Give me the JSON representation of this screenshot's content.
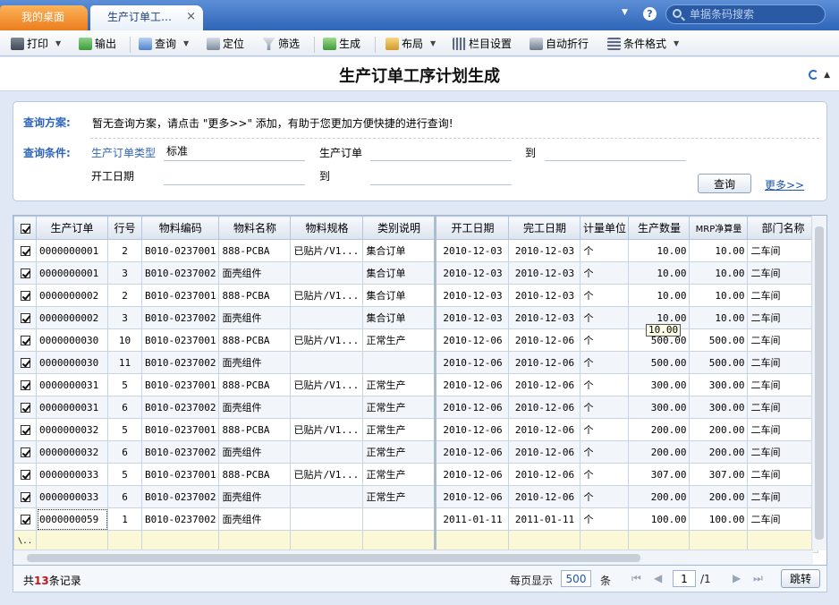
{
  "tabs": {
    "home": "我的桌面",
    "active": "生产订单工…",
    "close": "×"
  },
  "topbar": {
    "help": "?",
    "search_placeholder": "单据条码搜索"
  },
  "toolbar": {
    "print": "打印",
    "export": "输出",
    "query": "查询",
    "locate": "定位",
    "filter": "筛选",
    "generate": "生成",
    "layout": "布局",
    "columns": "栏目设置",
    "autowrap": "自动折行",
    "condformat": "条件格式"
  },
  "page": {
    "title": "生产订单工序计划生成"
  },
  "query": {
    "scheme_label": "查询方案:",
    "scheme_text": "暂无查询方案，请点击 \"更多>>\" 添加，有助于您更加方便快捷的进行查询!",
    "cond_label": "查询条件:",
    "order_type_label": "生产订单类型",
    "order_type_value": "标准",
    "order_label": "生产订单",
    "order_from": "",
    "to1": "到",
    "order_to": "",
    "start_label": "开工日期",
    "start_from": "",
    "to2": "到",
    "start_to": "",
    "query_button": "查询",
    "more": "更多>>"
  },
  "grid": {
    "columns": [
      "生产订单",
      "行号",
      "物料编码",
      "物料名称",
      "物料规格",
      "类别说明",
      "开工日期",
      "完工日期",
      "计量单位",
      "生产数量",
      "MRP净算量",
      "部门名称"
    ],
    "rows": [
      {
        "order": "0000000001",
        "line": "2",
        "code": "B010-0237001",
        "name": "888-PCBA",
        "spec": "已贴片/V1...",
        "cat": "集合订单",
        "start": "2010-12-03",
        "end": "2010-12-03",
        "unit": "个",
        "qty": "10.00",
        "mrp": "10.00",
        "dept": "二车间"
      },
      {
        "order": "0000000001",
        "line": "3",
        "code": "B010-0237002",
        "name": "面壳组件",
        "spec": "",
        "cat": "集合订单",
        "start": "2010-12-03",
        "end": "2010-12-03",
        "unit": "个",
        "qty": "10.00",
        "mrp": "10.00",
        "dept": "二车间"
      },
      {
        "order": "0000000002",
        "line": "2",
        "code": "B010-0237001",
        "name": "888-PCBA",
        "spec": "已贴片/V1...",
        "cat": "集合订单",
        "start": "2010-12-03",
        "end": "2010-12-03",
        "unit": "个",
        "qty": "10.00",
        "mrp": "10.00",
        "dept": "二车间"
      },
      {
        "order": "0000000002",
        "line": "3",
        "code": "B010-0237002",
        "name": "面壳组件",
        "spec": "",
        "cat": "集合订单",
        "start": "2010-12-03",
        "end": "2010-12-03",
        "unit": "个",
        "qty": "10.00",
        "mrp": "10.00",
        "dept": "二车间"
      },
      {
        "order": "0000000030",
        "line": "10",
        "code": "B010-0237001",
        "name": "888-PCBA",
        "spec": "已贴片/V1...",
        "cat": "正常生产",
        "start": "2010-12-06",
        "end": "2010-12-06",
        "unit": "个",
        "qty": "500.00",
        "mrp": "500.00",
        "dept": "二车间"
      },
      {
        "order": "0000000030",
        "line": "11",
        "code": "B010-0237002",
        "name": "面壳组件",
        "spec": "",
        "cat": "",
        "start": "2010-12-06",
        "end": "2010-12-06",
        "unit": "个",
        "qty": "500.00",
        "mrp": "500.00",
        "dept": "二车间"
      },
      {
        "order": "0000000031",
        "line": "5",
        "code": "B010-0237001",
        "name": "888-PCBA",
        "spec": "已贴片/V1...",
        "cat": "正常生产",
        "start": "2010-12-06",
        "end": "2010-12-06",
        "unit": "个",
        "qty": "300.00",
        "mrp": "300.00",
        "dept": "二车间"
      },
      {
        "order": "0000000031",
        "line": "6",
        "code": "B010-0237002",
        "name": "面壳组件",
        "spec": "",
        "cat": "正常生产",
        "start": "2010-12-06",
        "end": "2010-12-06",
        "unit": "个",
        "qty": "300.00",
        "mrp": "300.00",
        "dept": "二车间"
      },
      {
        "order": "0000000032",
        "line": "5",
        "code": "B010-0237001",
        "name": "888-PCBA",
        "spec": "已贴片/V1...",
        "cat": "正常生产",
        "start": "2010-12-06",
        "end": "2010-12-06",
        "unit": "个",
        "qty": "200.00",
        "mrp": "200.00",
        "dept": "二车间"
      },
      {
        "order": "0000000032",
        "line": "6",
        "code": "B010-0237002",
        "name": "面壳组件",
        "spec": "",
        "cat": "正常生产",
        "start": "2010-12-06",
        "end": "2010-12-06",
        "unit": "个",
        "qty": "200.00",
        "mrp": "200.00",
        "dept": "二车间"
      },
      {
        "order": "0000000033",
        "line": "5",
        "code": "B010-0237001",
        "name": "888-PCBA",
        "spec": "已贴片/V1...",
        "cat": "正常生产",
        "start": "2010-12-06",
        "end": "2010-12-06",
        "unit": "个",
        "qty": "307.00",
        "mrp": "307.00",
        "dept": "二车间"
      },
      {
        "order": "0000000033",
        "line": "6",
        "code": "B010-0237002",
        "name": "面壳组件",
        "spec": "",
        "cat": "正常生产",
        "start": "2010-12-06",
        "end": "2010-12-06",
        "unit": "个",
        "qty": "200.00",
        "mrp": "200.00",
        "dept": "二车间"
      },
      {
        "order": "0000000059",
        "line": "1",
        "code": "B010-0237002",
        "name": "面壳组件",
        "spec": "",
        "cat": "",
        "start": "2011-01-11",
        "end": "2011-01-11",
        "unit": "个",
        "qty": "100.00",
        "mrp": "100.00",
        "dept": "二车间"
      }
    ],
    "tooltip": "10.00",
    "new_row_marker": "\\.."
  },
  "footer": {
    "prefix": "共",
    "count": "13",
    "suffix": "条记录",
    "per_page_label": "每页显示",
    "per_page": "500",
    "per_page_unit": "条",
    "current_page": "1",
    "total_pages": "/1",
    "go": "跳转"
  }
}
